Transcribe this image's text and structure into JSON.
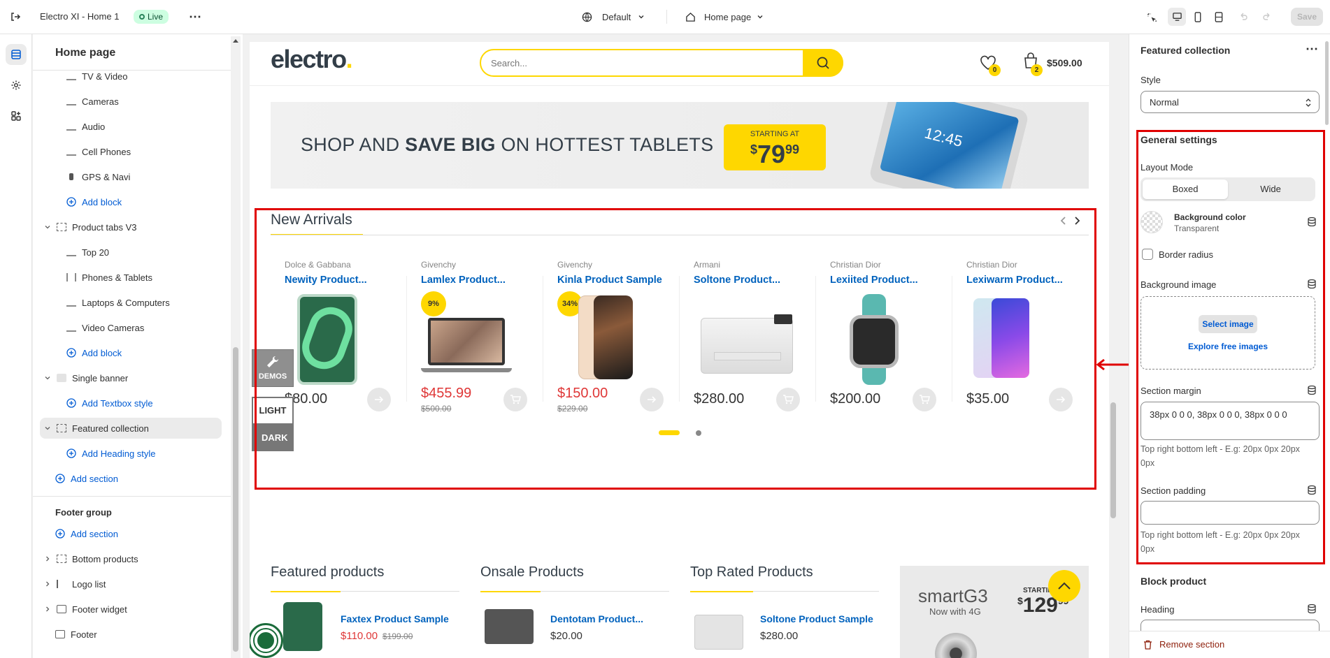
{
  "topbar": {
    "store_name": "Electro XI - Home 1",
    "live_badge": "Live",
    "theme_select": "Default",
    "page_select": "Home page",
    "save_label": "Save"
  },
  "sidebar": {
    "title": "Home page",
    "items": [
      "TV & Video",
      "Cameras",
      "Audio",
      "Cell Phones",
      "GPS & Navi",
      "Add block",
      "Product tabs V3",
      "Top 20",
      "Phones & Tablets",
      "Laptops & Computers",
      "Video Cameras",
      "Add block",
      "Single banner",
      "Add Textbox style",
      "Featured collection",
      "Add Heading style",
      "Add section"
    ],
    "footer_group_title": "Footer group",
    "footer_items": [
      "Add section",
      "Bottom products",
      "Logo list",
      "Footer widget",
      "Footer"
    ]
  },
  "preview": {
    "logo": "electro",
    "logo_dot": ".",
    "search_placeholder": "Search...",
    "wishlist_count": "0",
    "cart_count": "2",
    "cart_total": "$509.00",
    "banner": {
      "text_pre": "SHOP AND ",
      "text_bold": "SAVE BIG",
      "text_post": " ON HOTTEST TABLETS",
      "starting_at": "STARTING AT",
      "price_currency": "$",
      "price_main": "79",
      "price_cents": "99",
      "tablet_time": "12:45"
    },
    "new_arrivals": {
      "title": "New Arrivals",
      "products": [
        {
          "brand": "Dolce & Gabbana",
          "name": "Newity Product...",
          "price": "$80.00",
          "old_price": "",
          "badge": ""
        },
        {
          "brand": "Givenchy",
          "name": "Lamlex Product...",
          "price": "$455.99",
          "old_price": "$500.00",
          "badge": "9%"
        },
        {
          "brand": "Givenchy",
          "name": "Kinla Product Sample",
          "price": "$150.00",
          "old_price": "$229.00",
          "badge": "34%"
        },
        {
          "brand": "Armani",
          "name": "Soltone Product...",
          "price": "$280.00",
          "old_price": "",
          "badge": ""
        },
        {
          "brand": "Christian Dior",
          "name": "Lexiited Product...",
          "price": "$200.00",
          "old_price": "",
          "badge": ""
        },
        {
          "brand": "Christian Dior",
          "name": "Lexiwarm Product...",
          "price": "$35.00",
          "old_price": "",
          "badge": ""
        }
      ]
    },
    "side_tools": {
      "demos": "DEMOS",
      "light": "LIGHT",
      "dark": "DARK"
    },
    "bottom": {
      "featured_title": "Featured products",
      "onsale_title": "Onsale Products",
      "toprated_title": "Top Rated Products",
      "featured_item": {
        "name": "Faxtex Product Sample",
        "price": "$110.00",
        "old_price": "$199.00"
      },
      "onsale_item": {
        "name": "Dentotam Product...",
        "price": "$20.00"
      },
      "toprated_item": {
        "name": "Soltone Product Sample",
        "price": "$280.00"
      },
      "ad": {
        "brand": "smartG3",
        "sub": "Now with 4G",
        "starting": "STARTING",
        "price_currency": "$",
        "price_main": "129",
        "price_cents": "99"
      }
    }
  },
  "panel": {
    "title": "Featured collection",
    "style_label": "Style",
    "style_value": "Normal",
    "general_heading": "General settings",
    "layout_mode_label": "Layout Mode",
    "layout_options": [
      "Boxed",
      "Wide"
    ],
    "bg_color_label": "Background color",
    "bg_color_value": "Transparent",
    "border_radius_label": "Border radius",
    "bg_image_label": "Background image",
    "select_image": "Select image",
    "explore_images": "Explore free images",
    "section_margin_label": "Section margin",
    "section_margin_value": "38px 0 0 0, 38px 0 0 0, 38px 0 0 0",
    "section_margin_help": "Top right bottom left - E.g: 20px 0px 20px 0px",
    "section_padding_label": "Section padding",
    "section_padding_value": "",
    "section_padding_help": "Top right bottom left - E.g: 20px 0px 20px 0px",
    "block_product_heading": "Block product",
    "heading_label": "Heading",
    "remove_section": "Remove section"
  },
  "colors": {
    "accent": "#fed700",
    "link": "#0062bd",
    "sale": "#df3737",
    "highlight": "#e00000"
  }
}
